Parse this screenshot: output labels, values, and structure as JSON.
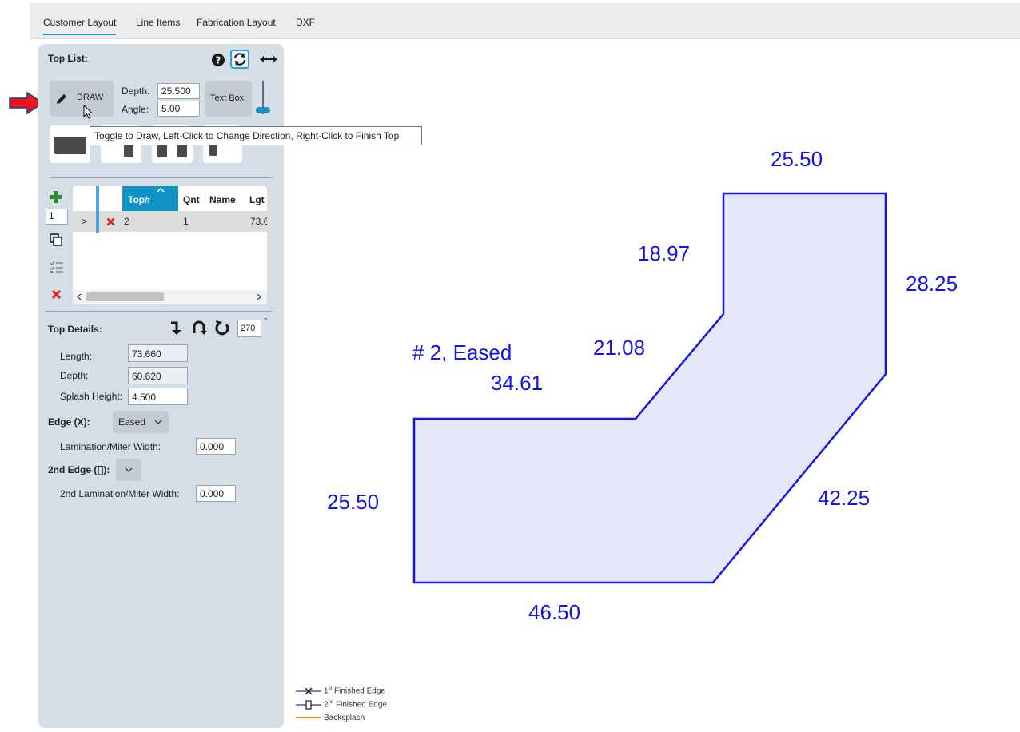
{
  "tabs": [
    "Customer Layout",
    "Line Items",
    "Fabrication Layout",
    "DXF"
  ],
  "top_list": {
    "title": "Top List:",
    "draw_label": "DRAW",
    "depth_label": "Depth:",
    "depth_value": "25.500",
    "angle_label": "Angle:",
    "angle_value": "5.00",
    "textbox_label": "Text Box",
    "tooltip": "Toggle to Draw, Left-Click to Change Direction, Right-Click to Finish Top"
  },
  "grid": {
    "quantity_input": "1",
    "columns": [
      "Top#",
      "Qnt",
      "Name",
      "Lgt"
    ],
    "rows": [
      {
        "expand": ">",
        "top": "2",
        "qnt": "1",
        "name": "",
        "lgt": "73.6"
      }
    ]
  },
  "details": {
    "title": "Top Details:",
    "rotation_value": "270",
    "degree_symbol": "°",
    "length_label": "Length:",
    "length_value": "73.660",
    "depth_label": "Depth:",
    "depth_value": "60.620",
    "splash_label": "Splash Height:",
    "splash_value": "4.500",
    "edge_label": "Edge (X):",
    "edge_value": "Eased",
    "lam_label": "Lamination/Miter Width:",
    "lam_value": "0.000",
    "edge2_label": "2nd Edge ([]):",
    "lam2_label": "2nd Lamination/Miter Width:",
    "lam2_value": "0.000"
  },
  "drawing": {
    "top_label": "# 2, Eased",
    "dims": {
      "top_edge": "25.50",
      "right_upper": "28.25",
      "inner_vertical": "18.97",
      "inner_diagonal": "21.08",
      "inner_horizontal": "34.61",
      "left_edge": "25.50",
      "right_diagonal": "42.25",
      "bottom_edge": "46.50"
    },
    "line_color": "#1414e6",
    "fill_color": "#e6e6fa"
  },
  "legend": {
    "first_pre": "1",
    "first_sup": "st",
    "first_post": " Finished Edge",
    "second_pre": "2",
    "second_sup": "nd",
    "second_post": " Finished Edge",
    "backsplash": "Backsplash"
  },
  "colors": {
    "accent": "#1f8fbf",
    "header_blue": "#0f93c4",
    "delete_red": "#e0201e",
    "add_green": "#2f8a2f",
    "arrow_red": "#e8161b"
  }
}
